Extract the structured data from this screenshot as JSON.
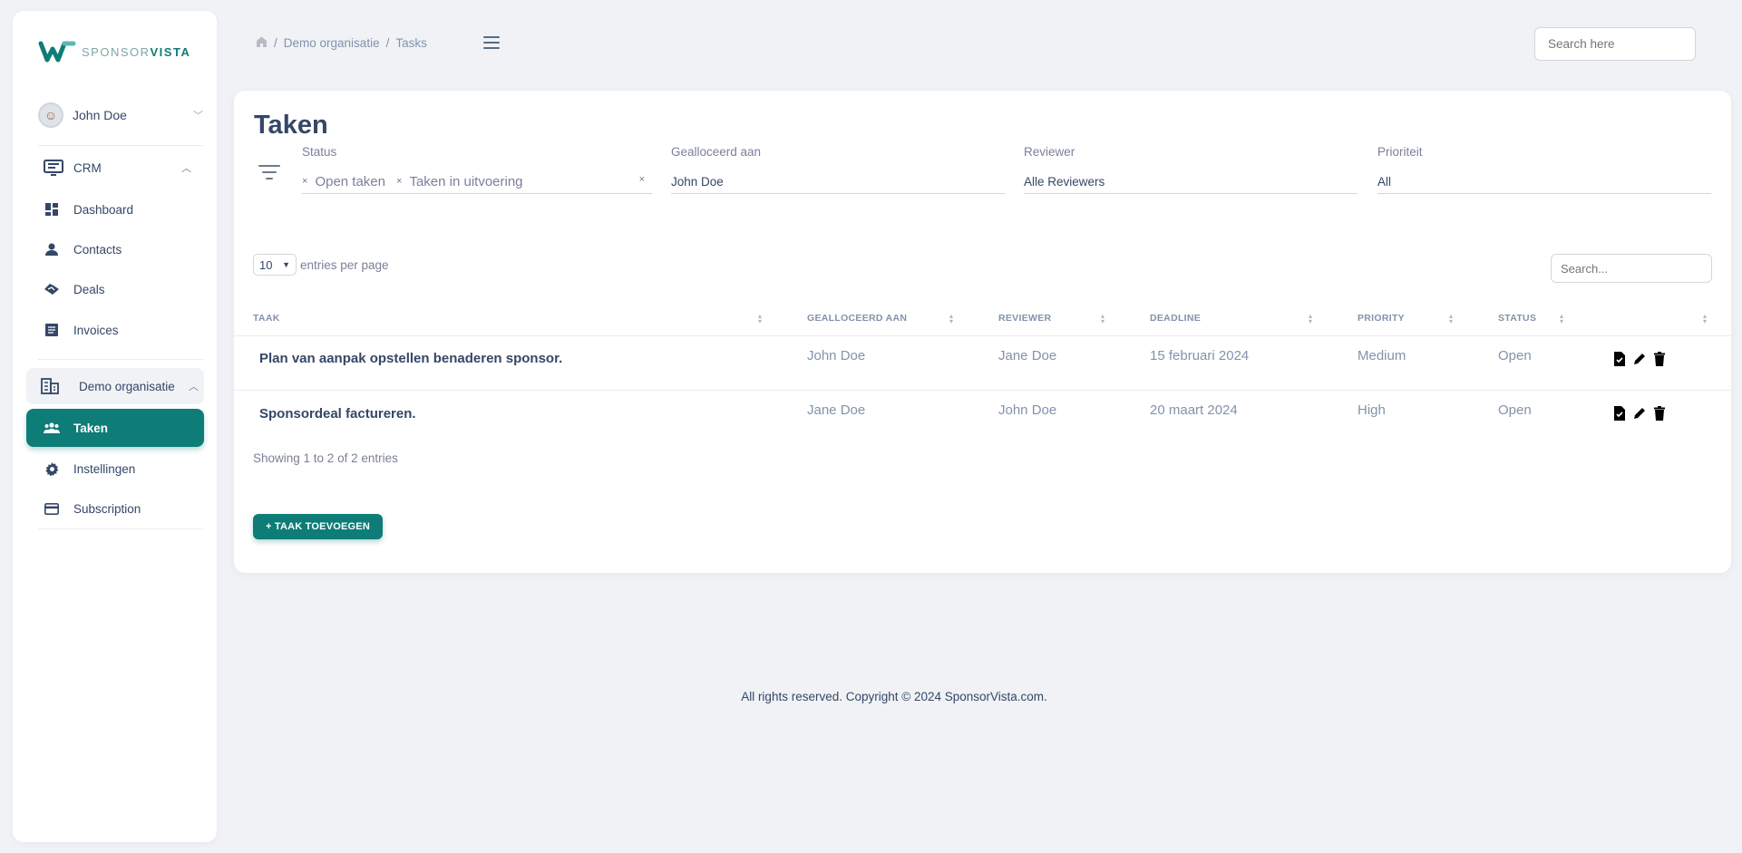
{
  "brand": {
    "name_light": "SPONSOR",
    "name_bold": "VISTA"
  },
  "user": {
    "name": "John Doe"
  },
  "sidebar": {
    "crm_label": "CRM",
    "items": [
      {
        "label": "Dashboard",
        "icon": "dashboard-icon"
      },
      {
        "label": "Contacts",
        "icon": "person-icon"
      },
      {
        "label": "Deals",
        "icon": "handshake-icon"
      },
      {
        "label": "Invoices",
        "icon": "invoice-icon"
      }
    ],
    "org_label": "Demo organisatie",
    "org_items": [
      {
        "label": "Taken",
        "icon": "group-icon",
        "active": true
      },
      {
        "label": "Instellingen",
        "icon": "gear-icon"
      },
      {
        "label": "Subscription",
        "icon": "credit-card-icon"
      }
    ]
  },
  "breadcrumb": {
    "org": "Demo organisatie",
    "page": "Tasks"
  },
  "top_search": {
    "placeholder": "Search here"
  },
  "page": {
    "title": "Taken"
  },
  "filters": {
    "status": {
      "label": "Status",
      "chips": [
        "Open taken",
        "Taken in uitvoering"
      ]
    },
    "allocated": {
      "label": "Gealloceerd aan",
      "value": "John Doe"
    },
    "reviewer": {
      "label": "Reviewer",
      "value": "Alle Reviewers"
    },
    "priority": {
      "label": "Prioriteit",
      "value": "All"
    }
  },
  "table_controls": {
    "page_size": "10",
    "entries_label": "entries per page",
    "search_placeholder": "Search..."
  },
  "table": {
    "headers": [
      "TAAK",
      "GEALLOCEERD AAN",
      "REVIEWER",
      "DEADLINE",
      "PRIORITY",
      "STATUS"
    ],
    "rows": [
      {
        "task": "Plan van aanpak opstellen benaderen sponsor.",
        "allocated": "John Doe",
        "reviewer": "Jane Doe",
        "deadline": "15 februari 2024",
        "priority": "Medium",
        "status": "Open"
      },
      {
        "task": "Sponsordeal factureren.",
        "allocated": "Jane Doe",
        "reviewer": "John Doe",
        "deadline": "20 maart 2024",
        "priority": "High",
        "status": "Open"
      }
    ]
  },
  "showing": "Showing 1 to 2 of 2 entries",
  "add_button": "+ TAAK TOEVOEGEN",
  "footer": "All rights reserved. Copyright © 2024 SponsorVista.com.",
  "colors": {
    "accent": "#0e7c77",
    "text": "#344767",
    "muted": "#8392ab"
  }
}
